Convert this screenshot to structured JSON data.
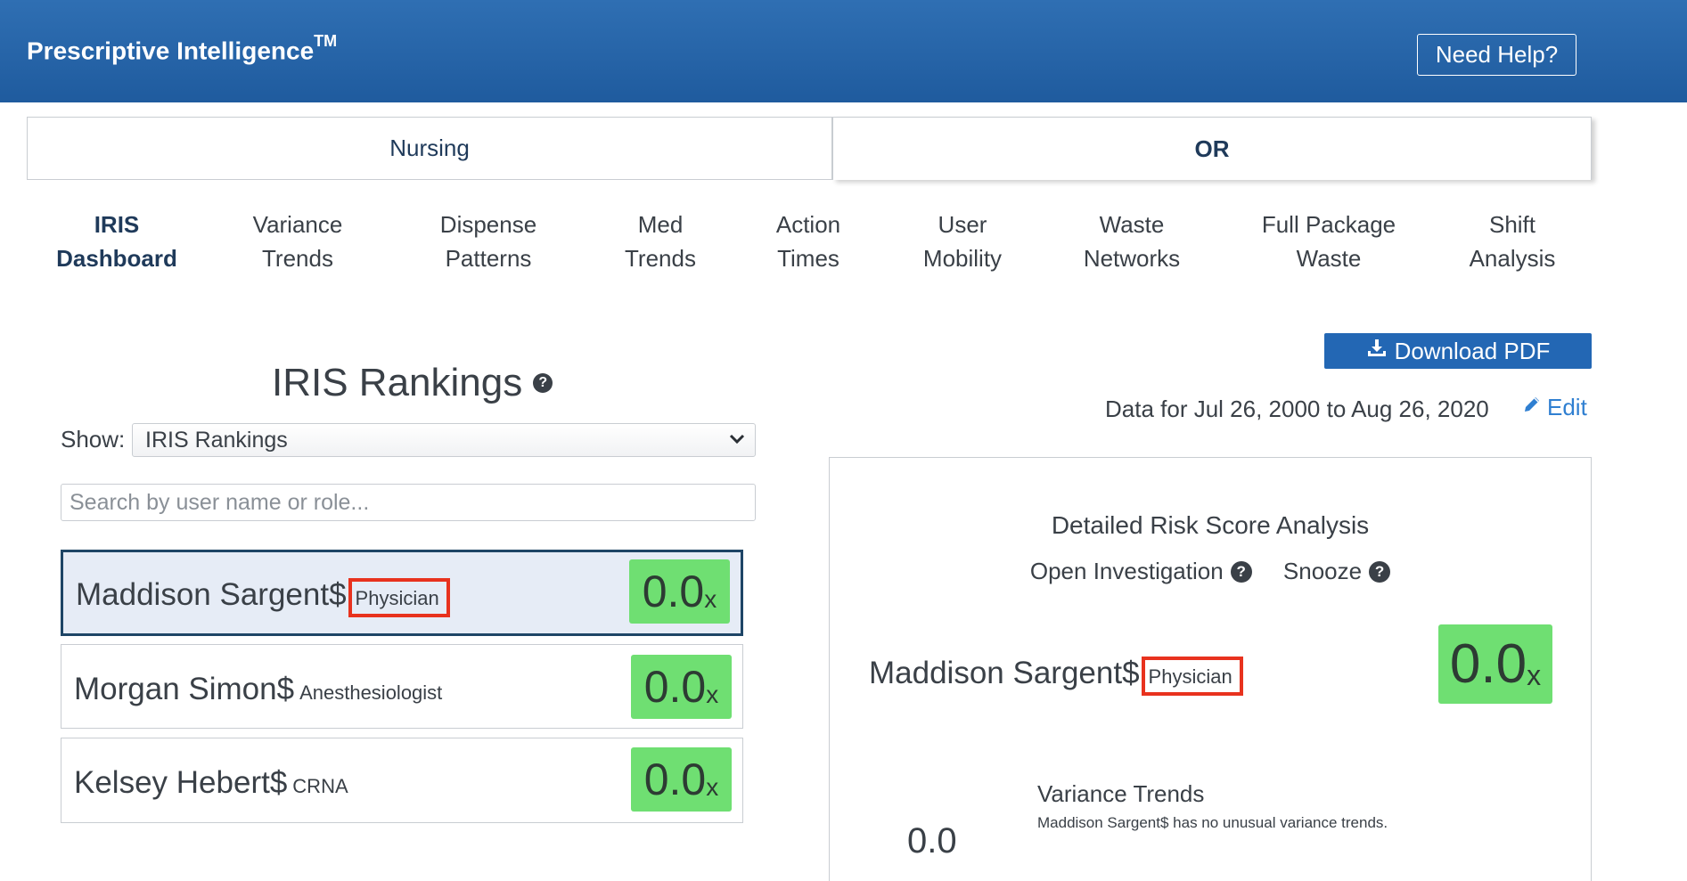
{
  "header": {
    "brand": "Prescriptive Intelligence",
    "brand_mark": "TM",
    "help_label": "Need Help?"
  },
  "tabs": [
    {
      "label": "Nursing",
      "active": false
    },
    {
      "label": "OR",
      "active": true
    }
  ],
  "subnav": [
    {
      "line1": "IRIS",
      "line2": "Dashboard",
      "active": true
    },
    {
      "line1": "Variance",
      "line2": "Trends"
    },
    {
      "line1": "Dispense",
      "line2": "Patterns"
    },
    {
      "line1": "Med",
      "line2": "Trends"
    },
    {
      "line1": "Action",
      "line2": "Times"
    },
    {
      "line1": "User",
      "line2": "Mobility"
    },
    {
      "line1": "Waste",
      "line2": "Networks"
    },
    {
      "line1": "Full Package",
      "line2": "Waste"
    },
    {
      "line1": "Shift",
      "line2": "Analysis"
    }
  ],
  "rankings": {
    "title": "IRIS Rankings",
    "show_label": "Show:",
    "show_value": "IRIS Rankings",
    "search_placeholder": "Search by user name or role...",
    "items": [
      {
        "name": "Maddison Sargent$",
        "role": "Physician",
        "score": "0.0",
        "score_suffix": "x",
        "selected": true,
        "highlighted_role": true
      },
      {
        "name": "Morgan Simon$",
        "role": "Anesthesiologist",
        "score": "0.0",
        "score_suffix": "x"
      },
      {
        "name": "Kelsey Hebert$",
        "role": "CRNA",
        "score": "0.0",
        "score_suffix": "x"
      }
    ]
  },
  "detail": {
    "download_label": "Download PDF",
    "date_range": "Data for Jul 26, 2000 to Aug 26, 2020",
    "edit_label": "Edit",
    "title": "Detailed Risk Score Analysis",
    "open_investigation": "Open Investigation",
    "snooze": "Snooze",
    "name": "Maddison Sargent$",
    "role": "Physician",
    "score": "0.0",
    "score_suffix": "x",
    "variance_value": "0.0",
    "variance_title": "Variance Trends",
    "variance_desc": "Maddison Sargent$ has no unusual variance trends."
  },
  "colors": {
    "header_blue": "#2367b4",
    "score_green": "#6fdf72",
    "highlight_red": "#e8321e",
    "selected_border": "#1e4566",
    "link_blue": "#2f7fd1"
  }
}
